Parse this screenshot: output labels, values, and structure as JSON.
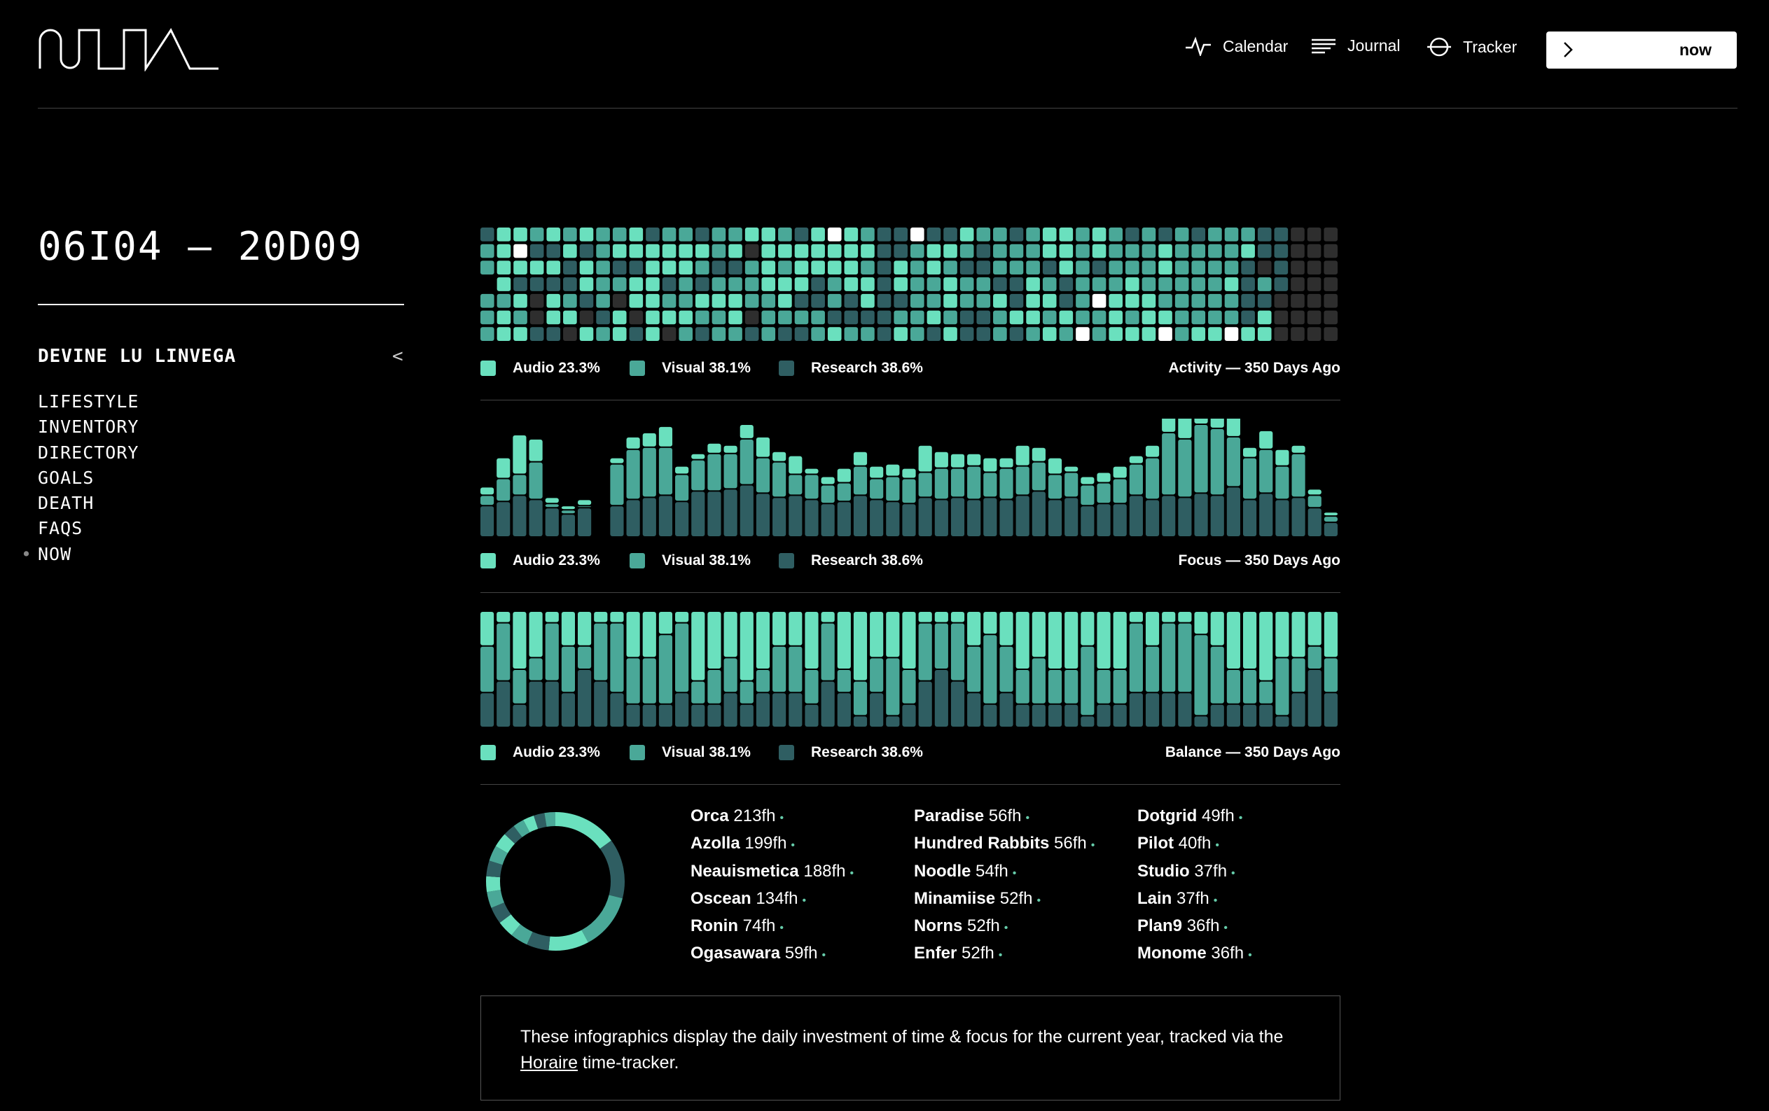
{
  "brand": {
    "logo_icon": "wave-logo-icon"
  },
  "nav": {
    "items": [
      {
        "label": "Calendar",
        "icon": "pulse-icon"
      },
      {
        "label": "Journal",
        "icon": "lines-icon"
      },
      {
        "label": "Tracker",
        "icon": "circle-line-icon"
      }
    ],
    "now_label": "now"
  },
  "page_title": "06I04 — 20D09",
  "sidebar": {
    "title": "DEVINE LU LINVEGA",
    "back": "<",
    "items": [
      "LIFESTYLE",
      "INVENTORY",
      "DIRECTORY",
      "GOALS",
      "DEATH",
      "FAQS",
      "NOW"
    ],
    "active_marker": "•"
  },
  "colors": {
    "audio": "#6ae0be",
    "visual": "#4aa898",
    "research": "#2f5e62",
    "empty": "#2e2e2e",
    "peak": "#ffffff"
  },
  "legend": {
    "audio": "Audio 23.3%",
    "visual": "Visual 38.1%",
    "research": "Research 38.6%"
  },
  "chart_data": [
    {
      "type": "heatmap",
      "title": "Activity — 350 Days Ago",
      "rows": 7,
      "columns": 52,
      "series": [
        "Audio",
        "Visual",
        "Research"
      ],
      "levels": [
        "rvvsvvv",
        "aaaavaa",
        "aparava",
        "vrareer",
        "araraar",
        "varrvae",
        "araarea",
        "vvvvvrv",
        "varveaa",
        "aaraaer",
        "raaaaaa",
        "vaarvae",
        "vaavvav",
        "ravravr",
        "vvrvavv",
        "varvaav",
        "aevvver",
        "aaaavvv",
        "vavaavr",
        "raaarvr",
        "aaarrvv",
        "paavvra",
        "aaaarrv",
        "vavaarv",
        "rrrrrrr",
        "rraarva",
        "pvvvvvv",
        "raavvar",
        "ravaava",
        "avrvvrr",
        "vrrvvrr",
        "vvvravv",
        "rvvrrar",
        "vvvaaav",
        "aarvava",
        "aaarrav",
        "vvvvvvp",
        "aarvpvv",
        "vvvvaaa",
        "rvvaava",
        "vvvvaaa",
        "raavvap",
        "vvvvvvv",
        "rvvvvva",
        "vvvvvva",
        "vvvavvp",
        "varrrra",
        "rrevraa",
        "rrrreee",
        "eeeeeee",
        "eeeeeee",
        "eeeeeee"
      ]
    },
    {
      "type": "bar",
      "title": "Focus — 350 Days Ago",
      "stacked": true,
      "series": [
        {
          "name": "Audio",
          "values": [
            4,
            10,
            19,
            11,
            3,
            2,
            3,
            0,
            3,
            6,
            7,
            10,
            4,
            3,
            5,
            4,
            7,
            10,
            5,
            9,
            3,
            4,
            7,
            7,
            6,
            6,
            5,
            13,
            8,
            7,
            6,
            7,
            5,
            10,
            7,
            8,
            3,
            4,
            5,
            6,
            4,
            6,
            12,
            14,
            13,
            14,
            11,
            5,
            9,
            8,
            4,
            3,
            2
          ]
        },
        {
          "name": "Visual",
          "values": [
            5,
            11,
            10,
            18,
            2,
            2,
            1,
            0,
            20,
            24,
            24,
            23,
            13,
            15,
            18,
            17,
            22,
            17,
            17,
            10,
            12,
            9,
            9,
            14,
            10,
            12,
            12,
            12,
            15,
            14,
            16,
            12,
            15,
            14,
            14,
            12,
            12,
            10,
            10,
            12,
            15,
            20,
            30,
            28,
            33,
            32,
            24,
            20,
            21,
            16,
            21,
            6,
            3
          ]
        },
        {
          "name": "Research",
          "values": [
            15,
            17,
            20,
            18,
            14,
            11,
            14,
            0,
            15,
            18,
            19,
            20,
            17,
            22,
            22,
            23,
            25,
            21,
            19,
            20,
            18,
            16,
            17,
            20,
            18,
            17,
            16,
            19,
            18,
            19,
            18,
            19,
            18,
            20,
            22,
            18,
            19,
            15,
            16,
            16,
            20,
            18,
            20,
            19,
            21,
            20,
            24,
            18,
            21,
            18,
            19,
            14,
            7
          ]
        }
      ]
    },
    {
      "type": "bar",
      "title": "Balance — 350 Days Ago",
      "stacked": true,
      "normalized": true,
      "series": [
        {
          "name": "Audio",
          "values": [
            30,
            10,
            50,
            40,
            10,
            30,
            30,
            10,
            10,
            40,
            40,
            20,
            10,
            60,
            50,
            40,
            60,
            50,
            30,
            30,
            50,
            10,
            50,
            60,
            40,
            40,
            50,
            10,
            10,
            10,
            30,
            20,
            30,
            50,
            40,
            50,
            50,
            30,
            50,
            50,
            10,
            30,
            10,
            10,
            20,
            30,
            50,
            50,
            60,
            40,
            40,
            30,
            40
          ]
        },
        {
          "name": "Visual",
          "values": [
            40,
            50,
            30,
            20,
            50,
            40,
            20,
            50,
            60,
            40,
            40,
            60,
            60,
            20,
            30,
            30,
            20,
            20,
            40,
            40,
            30,
            50,
            20,
            30,
            30,
            50,
            30,
            50,
            40,
            50,
            40,
            60,
            40,
            30,
            40,
            30,
            30,
            60,
            30,
            30,
            60,
            40,
            60,
            60,
            70,
            50,
            30,
            30,
            20,
            50,
            30,
            20,
            30
          ]
        },
        {
          "name": "Research",
          "values": [
            30,
            40,
            20,
            40,
            40,
            30,
            50,
            40,
            30,
            20,
            20,
            20,
            30,
            20,
            20,
            30,
            20,
            30,
            30,
            30,
            20,
            40,
            30,
            10,
            30,
            10,
            20,
            40,
            50,
            40,
            30,
            20,
            30,
            20,
            20,
            20,
            20,
            10,
            20,
            20,
            30,
            30,
            30,
            30,
            10,
            20,
            20,
            20,
            20,
            10,
            30,
            50,
            30
          ]
        }
      ]
    },
    {
      "type": "pie",
      "donut": true,
      "title": "",
      "slices": [
        {
          "name": "Orca",
          "value": 213
        },
        {
          "name": "Azolla",
          "value": 199
        },
        {
          "name": "Neauismetica",
          "value": 188
        },
        {
          "name": "Oscean",
          "value": 134
        },
        {
          "name": "Ronin",
          "value": 74
        },
        {
          "name": "Ogasawara",
          "value": 59
        },
        {
          "name": "Paradise",
          "value": 56
        },
        {
          "name": "Hundred Rabbits",
          "value": 56
        },
        {
          "name": "Noodle",
          "value": 54
        },
        {
          "name": "Minamiise",
          "value": 52
        },
        {
          "name": "Norns",
          "value": 52
        },
        {
          "name": "Enfer",
          "value": 52
        },
        {
          "name": "Dotgrid",
          "value": 49
        },
        {
          "name": "Pilot",
          "value": 40
        },
        {
          "name": "Studio",
          "value": 37
        },
        {
          "name": "Lain",
          "value": 37
        },
        {
          "name": "Plan9",
          "value": 36
        },
        {
          "name": "Monome",
          "value": 36
        }
      ]
    }
  ],
  "projects": [
    [
      {
        "name": "Orca",
        "hours": "213fh"
      },
      {
        "name": "Azolla",
        "hours": "199fh"
      },
      {
        "name": "Neauismetica",
        "hours": "188fh"
      },
      {
        "name": "Oscean",
        "hours": "134fh"
      },
      {
        "name": "Ronin",
        "hours": "74fh"
      },
      {
        "name": "Ogasawara",
        "hours": "59fh"
      }
    ],
    [
      {
        "name": "Paradise",
        "hours": "56fh"
      },
      {
        "name": "Hundred Rabbits",
        "hours": "56fh"
      },
      {
        "name": "Noodle",
        "hours": "54fh"
      },
      {
        "name": "Minamiise",
        "hours": "52fh"
      },
      {
        "name": "Norns",
        "hours": "52fh"
      },
      {
        "name": "Enfer",
        "hours": "52fh"
      }
    ],
    [
      {
        "name": "Dotgrid",
        "hours": "49fh"
      },
      {
        "name": "Pilot",
        "hours": "40fh"
      },
      {
        "name": "Studio",
        "hours": "37fh"
      },
      {
        "name": "Lain",
        "hours": "37fh"
      },
      {
        "name": "Plan9",
        "hours": "36fh"
      },
      {
        "name": "Monome",
        "hours": "36fh"
      }
    ]
  ],
  "project_dot": "•",
  "note": {
    "before": "These infographics display the daily investment of time & focus for the current year, tracked via the ",
    "link": "Horaire",
    "after": " time-tracker."
  }
}
